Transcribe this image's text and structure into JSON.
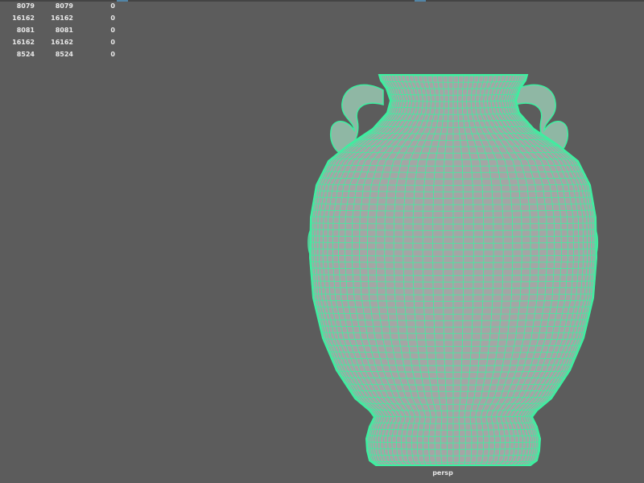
{
  "viewport": {
    "camera_label": "persp",
    "background_color": "#5c5c5c",
    "wireframe_color": "#3cf0a0",
    "surface_color": "#a5a5a5"
  },
  "hud": {
    "rows": [
      [
        "8079",
        "8079",
        "0"
      ],
      [
        "16162",
        "16162",
        "0"
      ],
      [
        "8081",
        "8081",
        "0"
      ],
      [
        "16162",
        "16162",
        "0"
      ],
      [
        "8524",
        "8524",
        "0"
      ]
    ]
  },
  "model": {
    "name": "vase-mesh",
    "display": "wireframe-on-shaded"
  }
}
